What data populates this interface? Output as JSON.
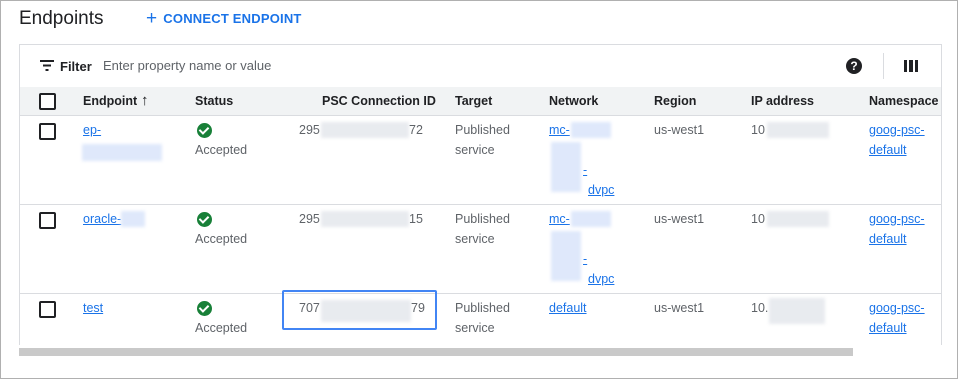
{
  "header": {
    "title": "Endpoints",
    "connect_button": "CONNECT ENDPOINT",
    "plus_glyph": "+"
  },
  "filter": {
    "label": "Filter",
    "placeholder": "Enter property name or value",
    "icon": "filter-icon",
    "help_icon": "help-icon",
    "help_glyph": "?",
    "columns_icon": "column-display-icon"
  },
  "table": {
    "columns": {
      "endpoint": "Endpoint",
      "status": "Status",
      "psc_id": "PSC Connection ID",
      "target": "Target",
      "network": "Network",
      "region": "Region",
      "ip": "IP address",
      "namespace": "Namespace"
    },
    "sort_glyph": "↑",
    "rows": [
      {
        "endpoint": "ep-",
        "status": "Accepted",
        "psc_start": "295",
        "psc_end": "72",
        "target_line1": "Published",
        "target_line2": "service",
        "network_parts": [
          "mc-",
          "-",
          "dvpc"
        ],
        "region": "us-west1",
        "ip": "10",
        "namespace_line1": "goog-psc-",
        "namespace_line2": "default"
      },
      {
        "endpoint": "oracle-",
        "status": "Accepted",
        "psc_start": "295",
        "psc_end": "15",
        "target_line1": "Published",
        "target_line2": "service",
        "network_parts": [
          "mc-",
          "-",
          "dvpc"
        ],
        "region": "us-west1",
        "ip": "10",
        "namespace_line1": "goog-psc-",
        "namespace_line2": "default"
      },
      {
        "endpoint": "test",
        "status": "Accepted",
        "psc_start": "707",
        "psc_end": "79",
        "target_line1": "Published",
        "target_line2": "service",
        "network": "default",
        "region": "us-west1",
        "ip": "10.",
        "namespace_line1": "goog-psc-",
        "namespace_line2": "default"
      }
    ]
  },
  "colors": {
    "accent": "#1a73e8",
    "status_ok": "#188038",
    "header_bg": "#f1f3f4",
    "focus": "#4285f4"
  }
}
